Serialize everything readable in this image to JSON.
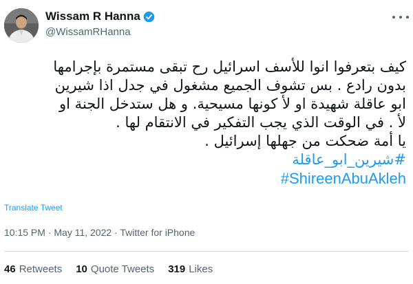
{
  "author": {
    "name": "Wissam R Hanna",
    "handle": "@WissamRHanna",
    "verified": true,
    "avatar_icon": "profile-photo-avatar"
  },
  "tweet": {
    "lines": [
      "كيف بتعرفوا انوا للأسف اسرائيل رح تبقى مستمرة بإجرامها",
      "بدون رادع . بس تشوف الجميع مشغول في جدل اذا شيرين",
      "ابو عاقلة شهيدة او لأ كونها مسيحية. و هل ستدخل الجنة او",
      "لأ . في الوقت الذي يجب التفكير في  الانتقام لها .",
      "يا أمة ضحكت من جهلها إسرائيل ."
    ],
    "hashtags": [
      "#شيرين_ابو_عاقلة",
      "#ShireenAbuAkleh"
    ]
  },
  "translate_label": "Translate Tweet",
  "meta": "10:15 PM · May 11, 2022 · Twitter for iPhone",
  "stats": {
    "retweets_count": "46",
    "retweets_label": "Retweets",
    "quotes_count": "10",
    "quotes_label": "Quote Tweets",
    "likes_count": "319",
    "likes_label": "Likes"
  },
  "colors": {
    "link": "#1d9bf0",
    "secondary_text": "#536471",
    "primary_text": "#0f1419"
  }
}
